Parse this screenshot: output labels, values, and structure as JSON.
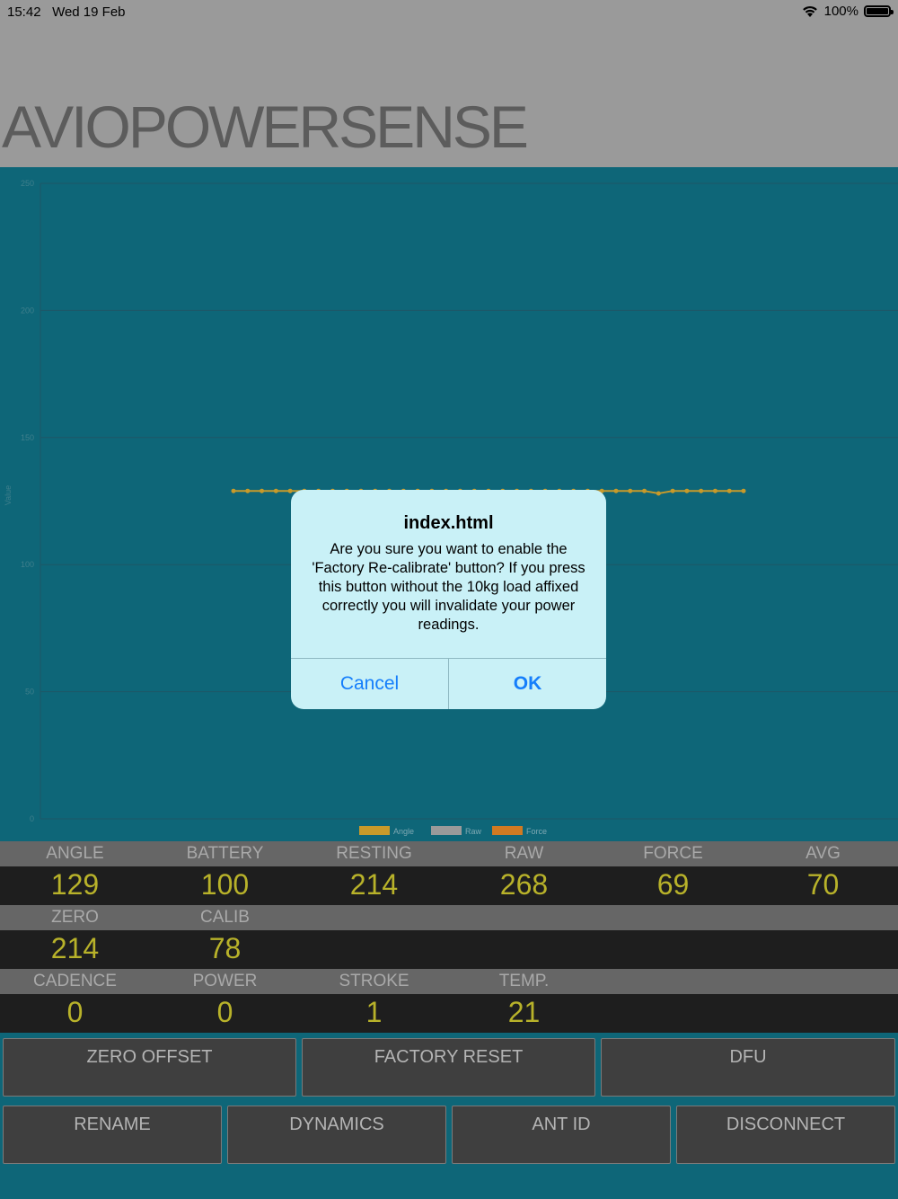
{
  "status_bar": {
    "time": "15:42",
    "date": "Wed 19 Feb",
    "battery": "100%",
    "wifi_icon": "wifi-icon",
    "battery_icon": "battery-icon"
  },
  "header": {
    "title": "AVIOPOWERSENSE"
  },
  "chart_data": {
    "type": "line",
    "ylabel": "Value",
    "ylim": [
      0,
      250
    ],
    "y_ticks": [
      "0",
      "50",
      "100",
      "150",
      "200",
      "250"
    ],
    "grid": true,
    "legend_position": "bottom",
    "series": [
      {
        "name": "Angle",
        "color": "#c89a2a",
        "values": [
          129,
          129,
          129,
          129,
          129,
          129,
          129,
          129,
          129,
          129,
          129,
          129,
          129,
          129,
          129,
          129,
          129,
          129,
          129,
          129,
          129,
          129,
          129,
          129,
          129,
          129,
          129,
          129,
          129,
          129,
          128,
          129,
          129,
          129,
          129,
          129,
          129
        ]
      },
      {
        "name": "Raw",
        "color": "#9a9a9a",
        "values": []
      },
      {
        "name": "Force",
        "color": "#d07a22",
        "values": []
      }
    ]
  },
  "table": {
    "row1": {
      "labels": [
        "ANGLE",
        "BATTERY",
        "RESTING",
        "RAW",
        "FORCE",
        "AVG"
      ],
      "values": [
        "129",
        "100",
        "214",
        "268",
        "69",
        "70"
      ]
    },
    "row2": {
      "labels": [
        "ZERO",
        "CALIB"
      ],
      "values": [
        "214",
        "78"
      ]
    },
    "row3": {
      "labels": [
        "CADENCE",
        "POWER",
        "STROKE",
        "TEMP."
      ],
      "values": [
        "0",
        "0",
        "1",
        "21"
      ]
    }
  },
  "buttons": {
    "zero_offset": "ZERO OFFSET",
    "factory_reset": "FACTORY RESET",
    "dfu": "DFU",
    "rename": "RENAME",
    "dynamics": "DYNAMICS",
    "ant_id": "ANT ID",
    "disconnect": "DISCONNECT"
  },
  "dialog": {
    "title": "index.html",
    "message": "Are you sure you want to enable the 'Factory Re-calibrate' button?  If you press this button without the 10kg load affixed correctly you will invalidate your power readings.",
    "cancel": "Cancel",
    "ok": "OK"
  }
}
